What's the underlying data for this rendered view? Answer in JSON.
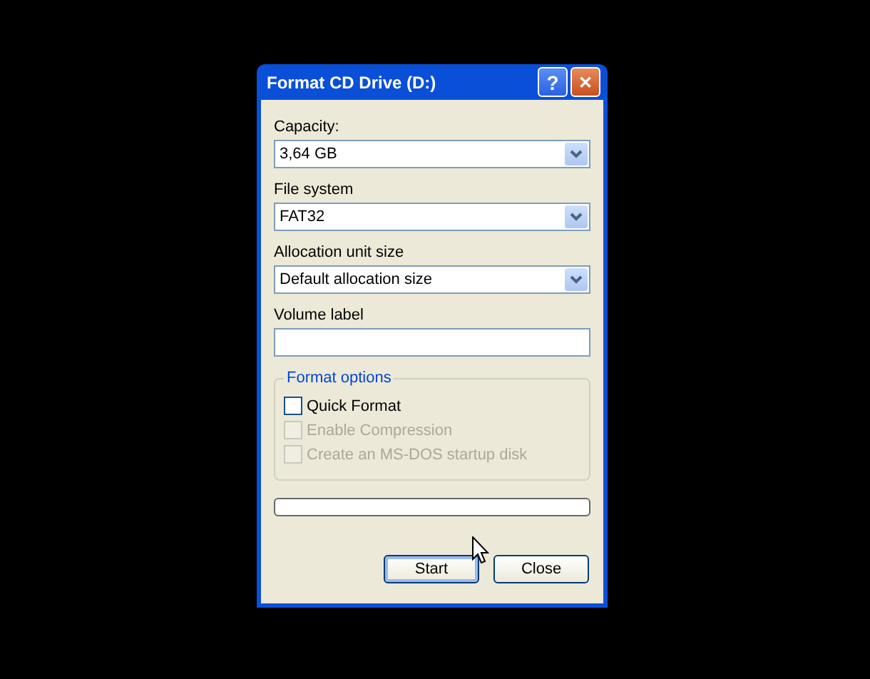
{
  "window": {
    "title": "Format CD Drive (D:)",
    "title_buttons": [
      {
        "kind": "help",
        "label": "?"
      },
      {
        "kind": "close",
        "label": "✕"
      }
    ]
  },
  "fields": [
    {
      "kind": "combo",
      "label": "Capacity:",
      "value": "3,64 GB"
    },
    {
      "kind": "combo",
      "label": "File system",
      "value": "FAT32"
    },
    {
      "kind": "combo",
      "label": "Allocation unit size",
      "value": "Default allocation size"
    },
    {
      "kind": "text",
      "label": "Volume label"
    }
  ],
  "format_options": {
    "title": "Format options",
    "options": [
      {
        "label": "Quick Format",
        "checked": false,
        "disabled": false
      },
      {
        "label": "Enable Compression",
        "checked": false,
        "disabled": true
      },
      {
        "label": "Create an MS-DOS startup disk",
        "checked": false,
        "disabled": true
      }
    ]
  },
  "progress": {
    "level": 0
  },
  "buttons": [
    {
      "label": "Start",
      "default": true
    },
    {
      "label": "Close",
      "default": false
    }
  ]
}
